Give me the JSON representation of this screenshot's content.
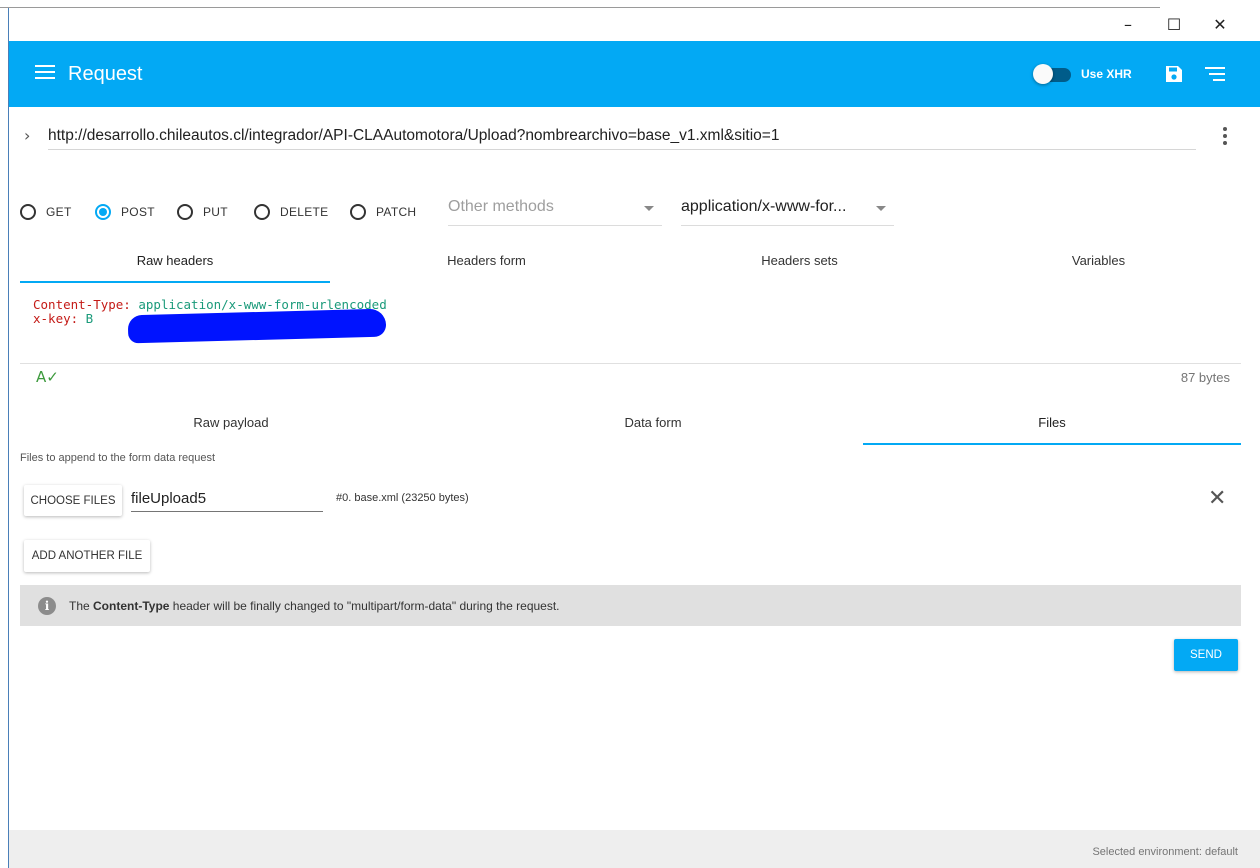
{
  "window": {
    "minimize_glyph": "–",
    "maximize_glyph": "☐",
    "close_glyph": "✕"
  },
  "toolbar": {
    "title": "Request",
    "use_xhr_label": "Use XHR",
    "use_xhr_enabled": false,
    "menu_icon": "menu-icon",
    "save_icon": "save-icon",
    "list_icon": "list-icon",
    "accent_color": "#03a9f4"
  },
  "url": {
    "value": "http://desarrollo.chileautos.cl/integrador/API-CLAAutomotora/Upload?nombrearchivo=base_v1.xml&sitio=1",
    "expand_glyph": "›"
  },
  "methods": {
    "options": [
      "GET",
      "POST",
      "PUT",
      "DELETE",
      "PATCH"
    ],
    "selected": "POST",
    "other_methods_label": "Other methods",
    "content_type": "application/x-www-for..."
  },
  "header_tabs": {
    "items": [
      "Raw headers",
      "Headers form",
      "Headers sets",
      "Variables"
    ],
    "active": "Raw headers"
  },
  "headers": {
    "line1_name": "Content-Type:",
    "line1_value": " application/x-www-form-urlencoded",
    "line2_name": "x-key:",
    "line2_value_start": " B",
    "line2_value_end": "B",
    "size": "87 bytes",
    "spellcheck_glyph": "A✓"
  },
  "payload_tabs": {
    "items": [
      "Raw payload",
      "Data form",
      "Files"
    ],
    "active": "Files"
  },
  "files": {
    "hint": "Files to append to the form data request",
    "choose_label": "CHOOSE FILES",
    "field_name": "fileUpload5",
    "file_info": "#0. base.xml (23250 bytes)",
    "remove_glyph": "✕",
    "add_label": "ADD ANOTHER FILE"
  },
  "info": {
    "icon_glyph": "i",
    "text_before": "The ",
    "text_bold": "Content-Type",
    "text_after": "  header will be finally changed to \"multipart/form-data\" during the request."
  },
  "send_label": "SEND",
  "status": {
    "environment": "Selected environment: default"
  }
}
